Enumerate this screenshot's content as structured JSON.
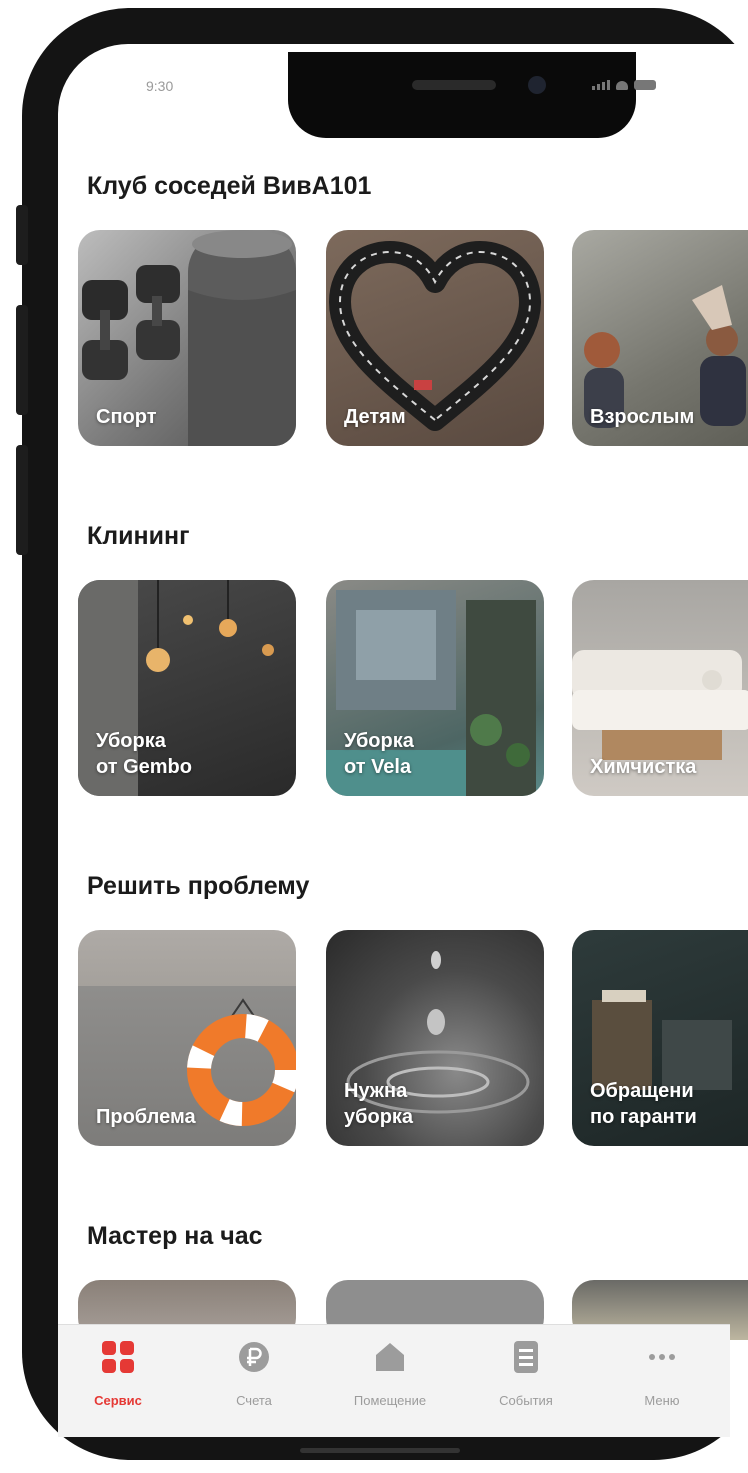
{
  "status_bar": {
    "time": "9:30"
  },
  "sections": [
    {
      "title": "Клуб соседей ВивА101",
      "cards": [
        {
          "label": "Спорт",
          "icon": "dumbbells-image"
        },
        {
          "label": "Детям",
          "icon": "heart-track-image"
        },
        {
          "label": "Взрослым",
          "icon": "adults-image"
        }
      ]
    },
    {
      "title": "Клининг",
      "cards": [
        {
          "label": "Уборка\nот Gembo",
          "icon": "lamps-image"
        },
        {
          "label": "Уборка\nот Vela",
          "icon": "storefront-image"
        },
        {
          "label": "Химчистка",
          "icon": "sofa-image"
        }
      ]
    },
    {
      "title": "Решить проблему",
      "cards": [
        {
          "label": "Проблема",
          "icon": "lifebuoy-image"
        },
        {
          "label": "Нужна\nуборка",
          "icon": "water-drop-image"
        },
        {
          "label": "Обращени\nпо гаранти",
          "icon": "warranty-image"
        }
      ]
    },
    {
      "title": "Мастер на час",
      "cards": []
    }
  ],
  "tabbar": {
    "items": [
      {
        "label": "Сервис",
        "icon": "services-grid-icon",
        "active": true
      },
      {
        "label": "Счета",
        "icon": "ruble-coin-icon",
        "active": false
      },
      {
        "label": "Помещение",
        "icon": "house-icon",
        "active": false
      },
      {
        "label": "События",
        "icon": "document-list-icon",
        "active": false
      },
      {
        "label": "Меню",
        "icon": "more-dots-icon",
        "active": false
      }
    ]
  },
  "colors": {
    "accent": "#e53935",
    "inactive": "#9c9c9c",
    "tabbar_bg": "#f3f3f3"
  }
}
